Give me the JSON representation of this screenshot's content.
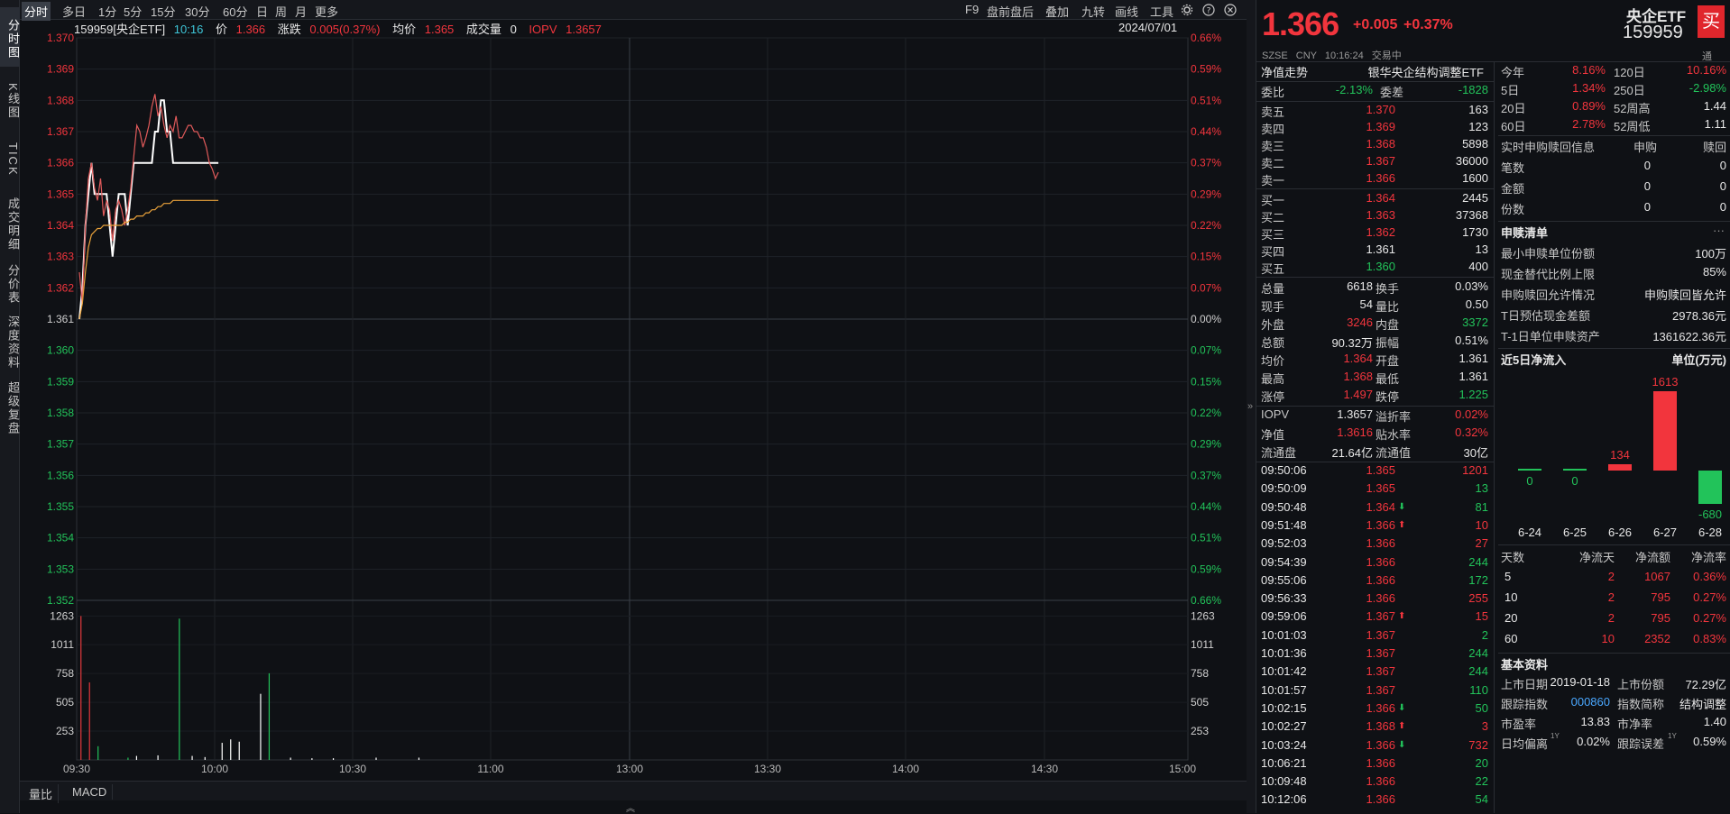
{
  "left_tabs": [
    "分时图",
    "K线图",
    "TICK",
    "成交明细",
    "分价表",
    "深度资料",
    "超级复盘"
  ],
  "toolbar": {
    "periods": [
      "分时",
      "多日",
      "1分",
      "5分",
      "15分",
      "30分",
      "60分",
      "日",
      "周",
      "月",
      "更多"
    ],
    "tools": [
      "F9",
      "盘前盘后",
      "叠加",
      "九转",
      "画线",
      "工具"
    ],
    "icons": [
      "gear-icon",
      "help-icon",
      "close-icon"
    ]
  },
  "info": {
    "code_name": "159959[央企ETF]",
    "time": "10:16",
    "price_label": "价",
    "price": "1.366",
    "change_label": "涨跌",
    "change": "0.005(0.37%)",
    "avg_label": "均价",
    "avg": "1.365",
    "volume_label": "成交量",
    "volume": "0",
    "iopv_label": "IOPV",
    "iopv": "1.3657",
    "date": "2024/07/01"
  },
  "chart_data": {
    "type": "line",
    "y_price_ticks": [
      "1.370",
      "1.369",
      "1.368",
      "1.367",
      "1.366",
      "1.365",
      "1.364",
      "1.363",
      "1.362",
      "1.361",
      "1.360",
      "1.359",
      "1.358",
      "1.357",
      "1.356",
      "1.355",
      "1.354",
      "1.353",
      "1.352"
    ],
    "y_pct_ticks": [
      "0.66%",
      "0.59%",
      "0.51%",
      "0.44%",
      "0.37%",
      "0.29%",
      "0.22%",
      "0.15%",
      "0.07%",
      "0.00%",
      "0.07%",
      "0.15%",
      "0.22%",
      "0.29%",
      "0.37%",
      "0.44%",
      "0.51%",
      "0.59%",
      "0.66%"
    ],
    "x_ticks": [
      "09:30",
      "10:00",
      "10:30",
      "11:00",
      "13:00",
      "13:30",
      "14:00",
      "14:30",
      "15:00"
    ],
    "vol_ticks": [
      "1263",
      "1011",
      "758",
      "505",
      "253"
    ],
    "ylim": [
      1.352,
      1.37
    ],
    "series": [
      {
        "color": "#ffffff",
        "values": [
          [
            0,
            1.361
          ],
          [
            1,
            1.362
          ],
          [
            2,
            1.364
          ],
          [
            3,
            1.365
          ],
          [
            4,
            1.366
          ],
          [
            5,
            1.365
          ],
          [
            6,
            1.365
          ],
          [
            7,
            1.365
          ],
          [
            8,
            1.365
          ],
          [
            9,
            1.365
          ],
          [
            10,
            1.364
          ],
          [
            11,
            1.363
          ],
          [
            12,
            1.364
          ],
          [
            13,
            1.365
          ],
          [
            14,
            1.365
          ],
          [
            15,
            1.365
          ],
          [
            16,
            1.364
          ],
          [
            17,
            1.365
          ],
          [
            18,
            1.366
          ],
          [
            19,
            1.366
          ],
          [
            20,
            1.366
          ],
          [
            21,
            1.366
          ],
          [
            22,
            1.366
          ],
          [
            23,
            1.366
          ],
          [
            24,
            1.366
          ],
          [
            25,
            1.367
          ],
          [
            26,
            1.367
          ],
          [
            27,
            1.368
          ],
          [
            28,
            1.368
          ],
          [
            29,
            1.367
          ],
          [
            30,
            1.367
          ],
          [
            31,
            1.366
          ],
          [
            32,
            1.366
          ],
          [
            33,
            1.366
          ],
          [
            34,
            1.366
          ],
          [
            35,
            1.366
          ],
          [
            36,
            1.366
          ],
          [
            37,
            1.366
          ],
          [
            38,
            1.366
          ],
          [
            39,
            1.366
          ],
          [
            40,
            1.366
          ],
          [
            41,
            1.366
          ],
          [
            42,
            1.366
          ],
          [
            43,
            1.366
          ],
          [
            44,
            1.366
          ],
          [
            45,
            1.366
          ],
          [
            46,
            1.366
          ]
        ]
      },
      {
        "color": "#e05a5a",
        "values": [
          [
            0,
            1.3625
          ],
          [
            1,
            1.3615
          ],
          [
            2,
            1.364
          ],
          [
            3,
            1.3655
          ],
          [
            4,
            1.366
          ],
          [
            5,
            1.3652
          ],
          [
            6,
            1.3648
          ],
          [
            7,
            1.3655
          ],
          [
            8,
            1.3643
          ],
          [
            9,
            1.3648
          ],
          [
            10,
            1.3645
          ],
          [
            11,
            1.3635
          ],
          [
            12,
            1.3645
          ],
          [
            13,
            1.3648
          ],
          [
            14,
            1.3645
          ],
          [
            15,
            1.364
          ],
          [
            16,
            1.3645
          ],
          [
            17,
            1.3652
          ],
          [
            18,
            1.3662
          ],
          [
            19,
            1.3672
          ],
          [
            20,
            1.367
          ],
          [
            21,
            1.3665
          ],
          [
            22,
            1.3668
          ],
          [
            23,
            1.3672
          ],
          [
            24,
            1.3678
          ],
          [
            25,
            1.3682
          ],
          [
            26,
            1.3675
          ],
          [
            27,
            1.3678
          ],
          [
            28,
            1.3672
          ],
          [
            29,
            1.3668
          ],
          [
            30,
            1.3672
          ],
          [
            31,
            1.367
          ],
          [
            32,
            1.3675
          ],
          [
            33,
            1.3668
          ],
          [
            34,
            1.3668
          ],
          [
            35,
            1.367
          ],
          [
            36,
            1.3672
          ],
          [
            37,
            1.3672
          ],
          [
            38,
            1.367
          ],
          [
            39,
            1.367
          ],
          [
            40,
            1.3668
          ],
          [
            41,
            1.3668
          ],
          [
            42,
            1.3665
          ],
          [
            43,
            1.366
          ],
          [
            44,
            1.3658
          ],
          [
            45,
            1.3655
          ],
          [
            46,
            1.3657
          ]
        ]
      },
      {
        "color": "#e9a23b",
        "values": [
          [
            0,
            1.361
          ],
          [
            1,
            1.3615
          ],
          [
            2,
            1.3625
          ],
          [
            3,
            1.3633
          ],
          [
            4,
            1.3637
          ],
          [
            5,
            1.3638
          ],
          [
            6,
            1.3639
          ],
          [
            7,
            1.3639
          ],
          [
            8,
            1.364
          ],
          [
            9,
            1.364
          ],
          [
            10,
            1.364
          ],
          [
            11,
            1.364
          ],
          [
            12,
            1.364
          ],
          [
            13,
            1.364
          ],
          [
            14,
            1.364
          ],
          [
            15,
            1.3641
          ],
          [
            16,
            1.3641
          ],
          [
            17,
            1.3642
          ],
          [
            18,
            1.3642
          ],
          [
            19,
            1.3643
          ],
          [
            20,
            1.3643
          ],
          [
            21,
            1.3643
          ],
          [
            22,
            1.3644
          ],
          [
            23,
            1.3644
          ],
          [
            24,
            1.3645
          ],
          [
            25,
            1.3645
          ],
          [
            26,
            1.3646
          ],
          [
            27,
            1.3646
          ],
          [
            28,
            1.3647
          ],
          [
            29,
            1.3647
          ],
          [
            30,
            1.3647
          ],
          [
            31,
            1.3648
          ],
          [
            32,
            1.3648
          ],
          [
            33,
            1.3648
          ],
          [
            34,
            1.3648
          ],
          [
            35,
            1.3648
          ],
          [
            36,
            1.3648
          ],
          [
            37,
            1.3648
          ],
          [
            38,
            1.3648
          ],
          [
            39,
            1.3648
          ],
          [
            40,
            1.3648
          ],
          [
            41,
            1.3648
          ],
          [
            42,
            1.3648
          ],
          [
            43,
            1.3648
          ],
          [
            44,
            1.3648
          ],
          [
            45,
            1.3648
          ],
          [
            46,
            1.3648
          ]
        ]
      }
    ],
    "volume_bars": [
      [
        1,
        1263,
        "#e0383c"
      ],
      [
        3,
        680,
        "#e0383c"
      ],
      [
        5,
        120,
        "#22c35a"
      ],
      [
        12,
        20,
        "#22c35a"
      ],
      [
        14,
        35,
        "#ffffff"
      ],
      [
        19,
        40,
        "#ffffff"
      ],
      [
        24,
        1240,
        "#22c35a"
      ],
      [
        27,
        35,
        "#ffffff"
      ],
      [
        30,
        25,
        "#ffffff"
      ],
      [
        34,
        150,
        "#ffffff"
      ],
      [
        36,
        180,
        "#ffffff"
      ],
      [
        38,
        160,
        "#ffffff"
      ],
      [
        43,
        580,
        "#ffffff"
      ],
      [
        45,
        760,
        "#22c35a"
      ],
      [
        50,
        20,
        "#ffffff"
      ],
      [
        55,
        15,
        "#ffffff"
      ],
      [
        60,
        15,
        "#ffffff"
      ],
      [
        70,
        20,
        "#ffffff"
      ],
      [
        80,
        20,
        "#ffffff"
      ]
    ]
  },
  "bottom_tabs": [
    "量比",
    "MACD"
  ],
  "header": {
    "price": "1.366",
    "change": "+0.005",
    "change_pct": "+0.37%",
    "name": "央企ETF",
    "code": "159959",
    "buy": "买",
    "market": "SZSE",
    "currency": "CNY",
    "time": "10:16:24",
    "status": "交易中"
  },
  "nav": {
    "title": "净值走势",
    "fund_name": "银华央企结构调整ETF"
  },
  "weibi": {
    "l1": "委比",
    "v1": "-2.13%",
    "l2": "委差",
    "v2": "-1828"
  },
  "asks": [
    [
      "卖五",
      "1.370",
      "163"
    ],
    [
      "卖四",
      "1.369",
      "123"
    ],
    [
      "卖三",
      "1.368",
      "5898"
    ],
    [
      "卖二",
      "1.367",
      "36000"
    ],
    [
      "卖一",
      "1.366",
      "1600"
    ]
  ],
  "bids": [
    [
      "买一",
      "1.364",
      "2445"
    ],
    [
      "买二",
      "1.363",
      "37368"
    ],
    [
      "买三",
      "1.362",
      "1730"
    ],
    [
      "买四",
      "1.361",
      "13"
    ],
    [
      "买五",
      "1.360",
      "400"
    ]
  ],
  "stats": [
    [
      "总量",
      "6618",
      "换手",
      "0.03%"
    ],
    [
      "现手",
      "54",
      "量比",
      "0.50"
    ],
    [
      "外盘",
      "3246",
      "内盘",
      "3372"
    ],
    [
      "总额",
      "90.32万",
      "振幅",
      "0.51%"
    ],
    [
      "均价",
      "1.364",
      "开盘",
      "1.361"
    ],
    [
      "最高",
      "1.368",
      "最低",
      "1.361"
    ],
    [
      "涨停",
      "1.497",
      "跌停",
      "1.225"
    ]
  ],
  "stats2": [
    [
      "IOPV",
      "1.3657",
      "溢折率",
      "0.02%"
    ],
    [
      "净值",
      "1.3616",
      "贴水率",
      "0.32%"
    ],
    [
      "流通盘",
      "21.64亿",
      "流通值",
      "30亿"
    ]
  ],
  "ticks": [
    [
      "09:50:06",
      "1.365",
      "",
      "1201"
    ],
    [
      "09:50:09",
      "1.365",
      "",
      "13"
    ],
    [
      "09:50:48",
      "1.364",
      "down",
      "81"
    ],
    [
      "09:51:48",
      "1.366",
      "up",
      "10"
    ],
    [
      "09:52:03",
      "1.366",
      "",
      "27"
    ],
    [
      "09:54:39",
      "1.366",
      "",
      "244"
    ],
    [
      "09:55:06",
      "1.366",
      "",
      "172"
    ],
    [
      "09:56:33",
      "1.366",
      "",
      "255"
    ],
    [
      "09:59:06",
      "1.367",
      "up",
      "15"
    ],
    [
      "10:01:03",
      "1.367",
      "",
      "2"
    ],
    [
      "10:01:36",
      "1.367",
      "",
      "244"
    ],
    [
      "10:01:42",
      "1.367",
      "",
      "244"
    ],
    [
      "10:01:57",
      "1.367",
      "",
      "110"
    ],
    [
      "10:02:15",
      "1.366",
      "down",
      "50"
    ],
    [
      "10:02:27",
      "1.368",
      "up",
      "3"
    ],
    [
      "10:03:24",
      "1.366",
      "down",
      "732"
    ],
    [
      "10:06:21",
      "1.366",
      "",
      "20"
    ],
    [
      "10:09:48",
      "1.366",
      "",
      "22"
    ],
    [
      "10:12:06",
      "1.366",
      "",
      "54"
    ]
  ],
  "perf": [
    [
      "今年",
      "8.16%",
      "120日",
      "10.16%"
    ],
    [
      "5日",
      "1.34%",
      "250日",
      "-2.98%"
    ],
    [
      "20日",
      "0.89%",
      "52周高",
      "1.44"
    ],
    [
      "60日",
      "2.78%",
      "52周低",
      "1.11"
    ]
  ],
  "perf_top_icon": "通",
  "redeem": {
    "title": "实时申购赎回信息",
    "col1": "申购",
    "col2": "赎回",
    "rows": [
      [
        "笔数",
        "0",
        "0"
      ],
      [
        "金额",
        "0",
        "0"
      ],
      [
        "份数",
        "0",
        "0"
      ]
    ]
  },
  "subscribe": {
    "title": "申赎清单",
    "more": "···",
    "rows": [
      [
        "最小申赎单位份额",
        "100万"
      ],
      [
        "现金替代比例上限",
        "85%"
      ],
      [
        "申购赎回允许情况",
        "申购赎回皆允许"
      ],
      [
        "T日预估现金差额",
        "2978.36元"
      ],
      [
        "T-1日单位申赎资产",
        "1361622.36元"
      ]
    ]
  },
  "inflow": {
    "title": "近5日净流入",
    "unit": "单位(万元)",
    "bars": [
      [
        "6-24",
        0
      ],
      [
        "6-25",
        0
      ],
      [
        "6-26",
        134
      ],
      [
        "6-27",
        1613
      ],
      [
        "6-28",
        -680
      ]
    ],
    "head": [
      "天数",
      "净流天",
      "净流额",
      "净流率"
    ],
    "rows": [
      [
        "5",
        "2",
        "1067",
        "0.36%"
      ],
      [
        "10",
        "2",
        "795",
        "0.27%"
      ],
      [
        "20",
        "2",
        "795",
        "0.27%"
      ],
      [
        "60",
        "10",
        "2352",
        "0.83%"
      ]
    ]
  },
  "basic": {
    "title": "基本资料",
    "rows": [
      [
        "上市日期",
        "2019-01-18",
        "上市份额",
        "72.29亿"
      ],
      [
        "跟踪指数",
        "000860",
        "指数简称",
        "结构调整"
      ],
      [
        "市盈率",
        "13.83",
        "市净率",
        "1.40"
      ],
      [
        "日均偏离",
        "0.02%",
        "跟踪误差",
        "0.59%"
      ]
    ],
    "sup": "1Y"
  }
}
